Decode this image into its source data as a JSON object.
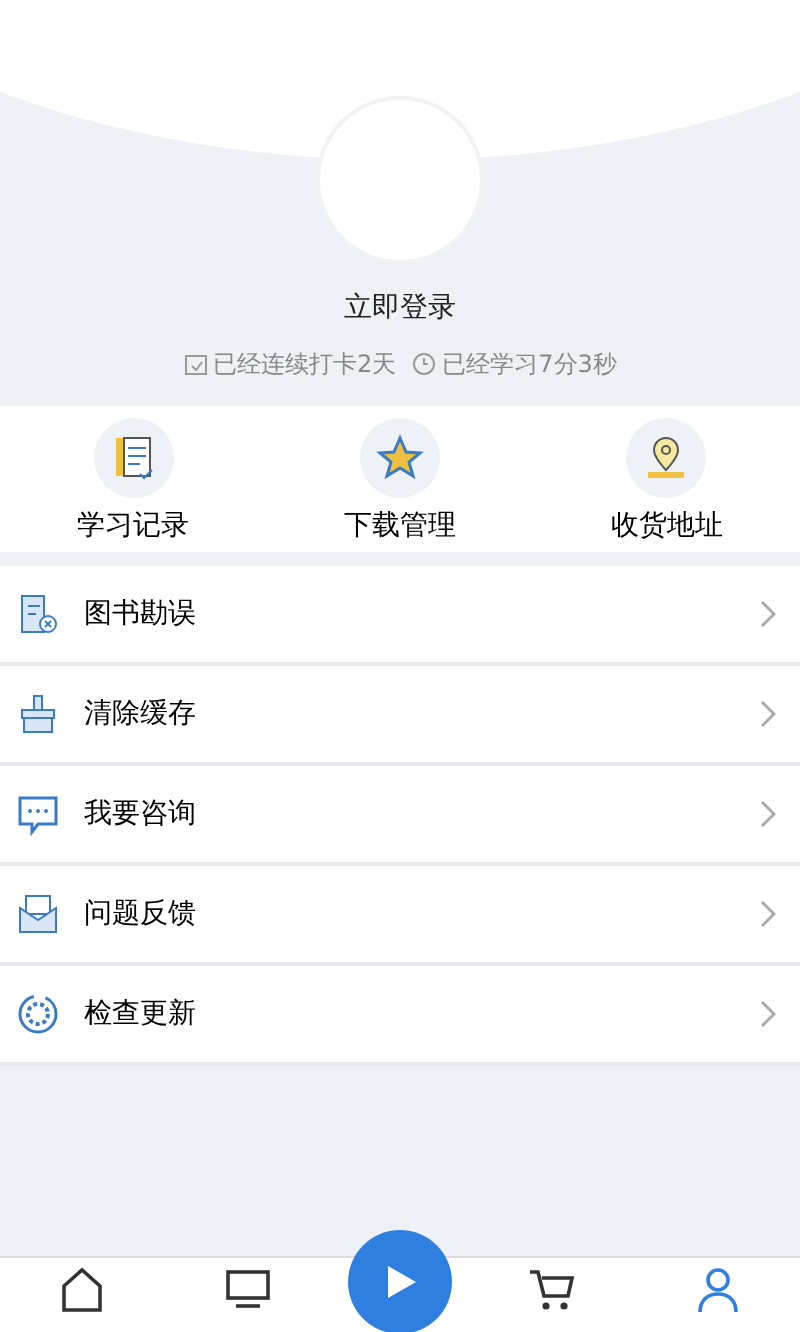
{
  "profile": {
    "login_label": "立即登录",
    "stats": [
      {
        "kind": "checkin",
        "text": "已经连续打卡2天"
      },
      {
        "kind": "clock",
        "text": "已经学习7分3秒"
      }
    ]
  },
  "shortcuts": [
    {
      "kind": "record",
      "label": "学习记录"
    },
    {
      "kind": "star",
      "label": "下载管理"
    },
    {
      "kind": "location",
      "label": "收货地址"
    }
  ],
  "menu": [
    {
      "kind": "book",
      "label": "图书勘误"
    },
    {
      "kind": "brush",
      "label": "清除缓存"
    },
    {
      "kind": "chat",
      "label": "我要咨询"
    },
    {
      "kind": "mail",
      "label": "问题反馈"
    },
    {
      "kind": "update",
      "label": "检查更新"
    }
  ],
  "tab_bar": [
    {
      "kind": "home",
      "selected": false
    },
    {
      "kind": "screen",
      "selected": false
    },
    {
      "kind": "play",
      "selected": false
    },
    {
      "kind": "cart",
      "selected": false
    },
    {
      "kind": "user",
      "selected": true
    }
  ]
}
